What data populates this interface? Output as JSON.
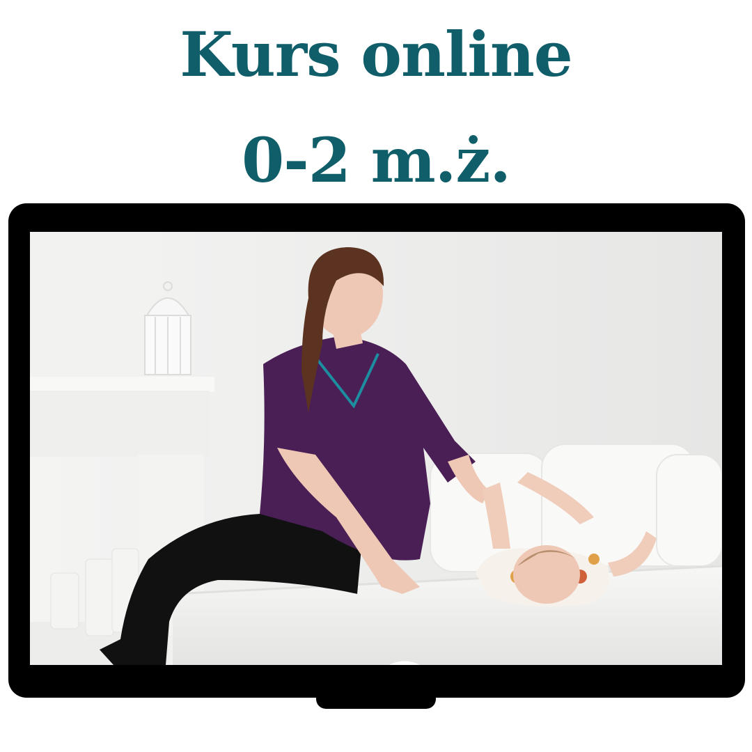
{
  "header": {
    "line1": "Kurs online",
    "line2": "0-2 m.ż."
  },
  "colors": {
    "title": "#0f5e69",
    "bezel": "#000000",
    "scrub": "#4a1f55",
    "wall": "#ecebea"
  },
  "video": {
    "scene": "therapist-with-baby-on-bed",
    "play_icon": "play-icon"
  }
}
